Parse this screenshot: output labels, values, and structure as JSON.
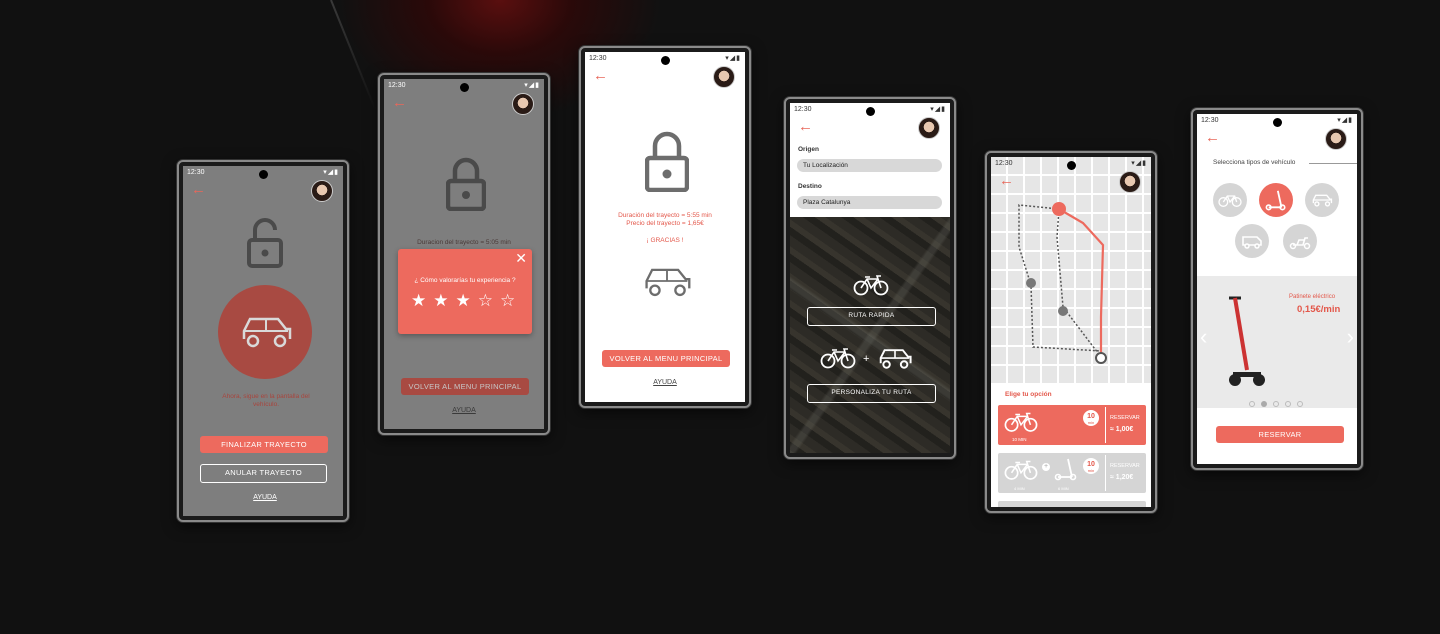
{
  "status_time": "12:30",
  "status_icons": "▾◢▮",
  "screens": {
    "s1": {
      "instruction": "Ahora, sigue en la pantalla del vehículo.",
      "finish": "FINALIZAR TRAYECTO",
      "cancel": "ANULAR TRAYECTO",
      "help": "AYUDA"
    },
    "s2": {
      "duration": "Duracion del trayecto = 5:05 min",
      "rating_question": "¿ Cómo valorarías tu experiencia ?",
      "stars_filled": 3,
      "stars_total": 5,
      "back_menu": "VOLVER AL MENU PRINCIPAL",
      "help": "AYUDA"
    },
    "s3": {
      "duration": "Duración del trayecto = 5:55 min",
      "price": "Precio del trayecto = 1,65€",
      "thanks": "¡ GRACIAS !",
      "back_menu": "VOLVER AL MENU PRINCIPAL",
      "help": "AYUDA"
    },
    "s4": {
      "origin_label": "Origen",
      "origin_value": "Tu Localización",
      "dest_label": "Destino",
      "dest_value": "Plaza Catalunya",
      "fast_route": "RUTA RAPIDA",
      "custom_route": "PERSONALIZA TU RUTA"
    },
    "s5": {
      "choose": "Elige tu opción",
      "opt1": {
        "num": "10",
        "unit": "min",
        "label": "10 MIN",
        "reserve": "RESERVAR",
        "price": "1,00€"
      },
      "opt2": {
        "num": "10",
        "unit": "min",
        "sub1": "4 MIN",
        "sub2": "6 MIN",
        "reserve": "RESERVAR",
        "price": "1,20€"
      },
      "approx": "≈"
    },
    "s6": {
      "title": "Selecciona tipos de vehículo",
      "product_name": "Patinete eléctrico",
      "product_price": "0,15€/min",
      "reserve": "RESERVAR",
      "carousel_dots": 5,
      "active_dot": 2
    }
  },
  "colors": {
    "accent": "#ed6a5e",
    "grey_overlay": "#7e7e7e",
    "dark_red": "#a84a42"
  }
}
